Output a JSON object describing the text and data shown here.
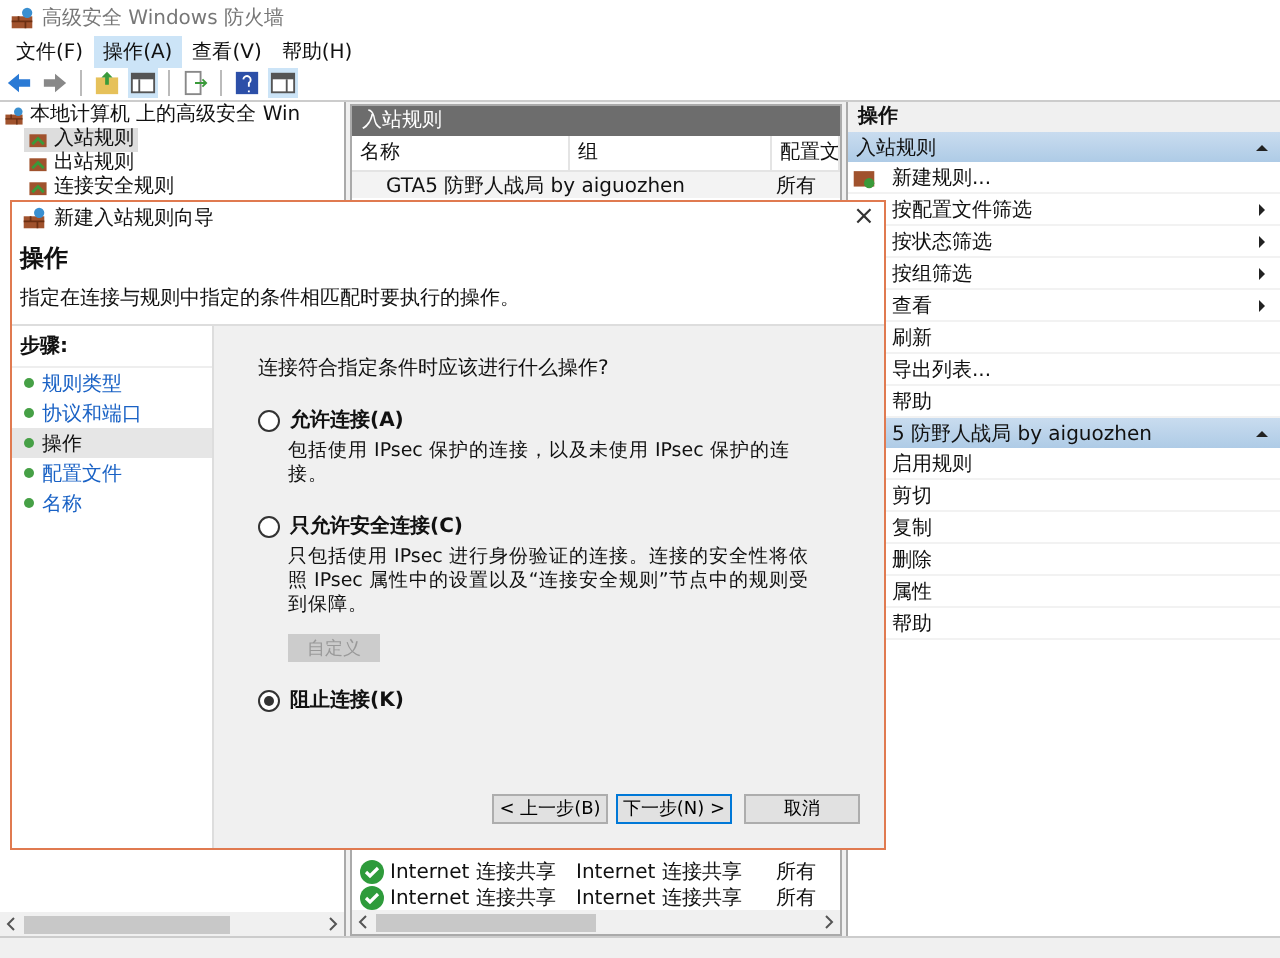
{
  "window": {
    "title": "高级安全 Windows 防火墙"
  },
  "menu": [
    {
      "label": "文件(F)",
      "selected": false
    },
    {
      "label": "操作(A)",
      "selected": true
    },
    {
      "label": "查看(V)",
      "selected": false
    },
    {
      "label": "帮助(H)",
      "selected": false
    }
  ],
  "tree": {
    "root": "本地计算机 上的高级安全 Win",
    "children": [
      {
        "label": "入站规则",
        "selected": true
      },
      {
        "label": "出站规则",
        "selected": false
      },
      {
        "label": "连接安全规则",
        "selected": false
      }
    ]
  },
  "rules": {
    "title": "入站规则",
    "columns": [
      "名称",
      "组",
      "配置文"
    ],
    "rows_above": [
      {
        "name": "GTA5 防野人战局 by aiguozhen",
        "profile": "所有",
        "enabled": false
      }
    ],
    "rows_below": [
      {
        "name": "Internet 连接共享",
        "group": "Internet 连接共享",
        "profile": "所有",
        "enabled": true
      },
      {
        "name": "Internet 连接共享",
        "group": "Internet 连接共享",
        "profile": "所有",
        "enabled": true
      }
    ]
  },
  "actions": {
    "title": "操作",
    "sections": [
      {
        "title": "入站规则",
        "expanded": true,
        "items": [
          {
            "label": "新建规则...",
            "kind": "icon"
          },
          {
            "label": "按配置文件筛选",
            "kind": "submenu"
          },
          {
            "label": "按状态筛选",
            "kind": "submenu"
          },
          {
            "label": "按组筛选",
            "kind": "submenu"
          },
          {
            "label": "查看",
            "kind": "submenu"
          },
          {
            "label": "刷新",
            "kind": "plain"
          },
          {
            "label": "导出列表...",
            "kind": "plain"
          },
          {
            "label": "帮助",
            "kind": "plain"
          }
        ]
      },
      {
        "title": "5 防野人战局 by aiguozhen",
        "expanded": true,
        "items": [
          {
            "label": "启用规则",
            "kind": "plain"
          },
          {
            "label": "剪切",
            "kind": "plain"
          },
          {
            "label": "复制",
            "kind": "plain"
          },
          {
            "label": "删除",
            "kind": "plain"
          },
          {
            "label": "属性",
            "kind": "plain"
          },
          {
            "label": "帮助",
            "kind": "plain"
          }
        ]
      }
    ]
  },
  "dialog": {
    "title": "新建入站规则向导",
    "close": "×",
    "heading": "操作",
    "description": "指定在连接与规则中指定的条件相匹配时要执行的操作。",
    "steps_title": "步骤:",
    "steps": [
      {
        "label": "规则类型",
        "selected": false
      },
      {
        "label": "协议和端口",
        "selected": false
      },
      {
        "label": "操作",
        "selected": true
      },
      {
        "label": "配置文件",
        "selected": false
      },
      {
        "label": "名称",
        "selected": false
      }
    ],
    "question": "连接符合指定条件时应该进行什么操作?",
    "options": [
      {
        "label": "允许连接(A)",
        "description": "包括使用 IPsec 保护的连接，以及未使用 IPsec 保护的连接。",
        "selected": false
      },
      {
        "label": "只允许安全连接(C)",
        "description": "只包括使用 IPsec 进行身份验证的连接。连接的安全性将依照 IPsec 属性中的设置以及“连接安全规则”节点中的规则受到保障。",
        "selected": false,
        "button": {
          "label": "自定义",
          "disabled": true
        }
      },
      {
        "label": "阻止连接(K)",
        "selected": true
      }
    ],
    "buttons": [
      "< 上一步(B)",
      "下一步(N) >",
      "取消"
    ]
  }
}
